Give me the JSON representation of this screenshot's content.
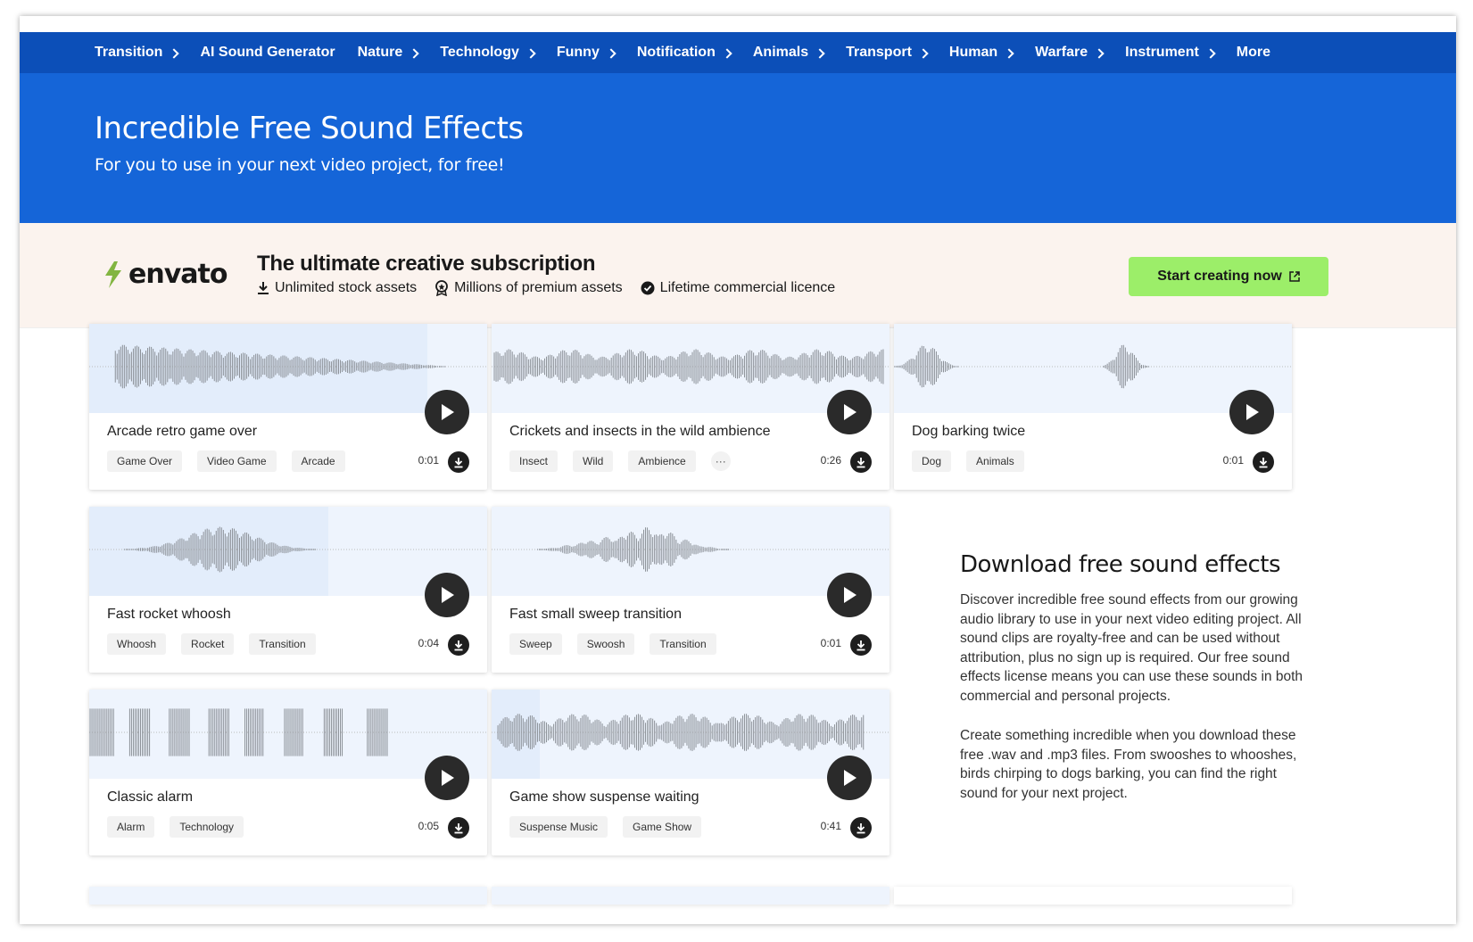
{
  "nav": {
    "items": [
      {
        "label": "Transition",
        "chevron": true
      },
      {
        "label": "AI Sound Generator",
        "chevron": false
      },
      {
        "label": "Nature",
        "chevron": true
      },
      {
        "label": "Technology",
        "chevron": true
      },
      {
        "label": "Funny",
        "chevron": true
      },
      {
        "label": "Notification",
        "chevron": true
      },
      {
        "label": "Animals",
        "chevron": true
      },
      {
        "label": "Transport",
        "chevron": true
      },
      {
        "label": "Human",
        "chevron": true
      },
      {
        "label": "Warfare",
        "chevron": true
      },
      {
        "label": "Instrument",
        "chevron": true
      },
      {
        "label": "More",
        "chevron": false
      }
    ]
  },
  "hero": {
    "title": "Incredible Free Sound Effects",
    "subtitle": "For you to use in your next video project, for free!"
  },
  "promo": {
    "logo_text": "envato",
    "title": "The ultimate creative subscription",
    "features": [
      "Unlimited stock assets",
      "Millions of premium assets",
      "Lifetime commercial licence"
    ],
    "cta_label": "Start creating now"
  },
  "sounds": [
    {
      "title": "Arcade retro game over",
      "tags": [
        "Game Over",
        "Video Game",
        "Arcade"
      ],
      "more": false,
      "duration": "0:01",
      "progress": 0.85
    },
    {
      "title": "Crickets and insects in the wild ambience",
      "tags": [
        "Insect",
        "Wild",
        "Ambience"
      ],
      "more": true,
      "duration": "0:26",
      "progress": 0.0
    },
    {
      "title": "Dog barking twice",
      "tags": [
        "Dog",
        "Animals"
      ],
      "more": false,
      "duration": "0:01",
      "progress": 0.0
    },
    {
      "title": "Fast rocket whoosh",
      "tags": [
        "Whoosh",
        "Rocket",
        "Transition"
      ],
      "more": false,
      "duration": "0:04",
      "progress": 0.6
    },
    {
      "title": "Fast small sweep transition",
      "tags": [
        "Sweep",
        "Swoosh",
        "Transition"
      ],
      "more": false,
      "duration": "0:01",
      "progress": 0.0
    },
    {
      "title": "Classic alarm",
      "tags": [
        "Alarm",
        "Technology"
      ],
      "more": false,
      "duration": "0:05",
      "progress": 0.0
    },
    {
      "title": "Game show suspense waiting",
      "tags": [
        "Suspense Music",
        "Game Show"
      ],
      "more": false,
      "duration": "0:41",
      "progress": 0.12
    }
  ],
  "more_tag_label": "···",
  "info": {
    "heading": "Download free sound effects",
    "para1": "Discover incredible free sound effects from our growing audio library to use in your next video editing project. All sound clips are royalty-free and can be used without attribution, plus no sign up is required. Our free sound effects license means you can use these sounds in both commercial and personal projects.",
    "para2": "Create something incredible when you download these free .wav and .mp3 files. From swooshes to whooshes, birds chirping to dogs barking, you can find the right sound for your next project."
  },
  "colors": {
    "nav_bg": "#0c4fb8",
    "hero_bg": "#1565d8",
    "promo_bg": "#fbf3ee",
    "cta_bg": "#9cee69",
    "logo_green": "#82b541"
  }
}
